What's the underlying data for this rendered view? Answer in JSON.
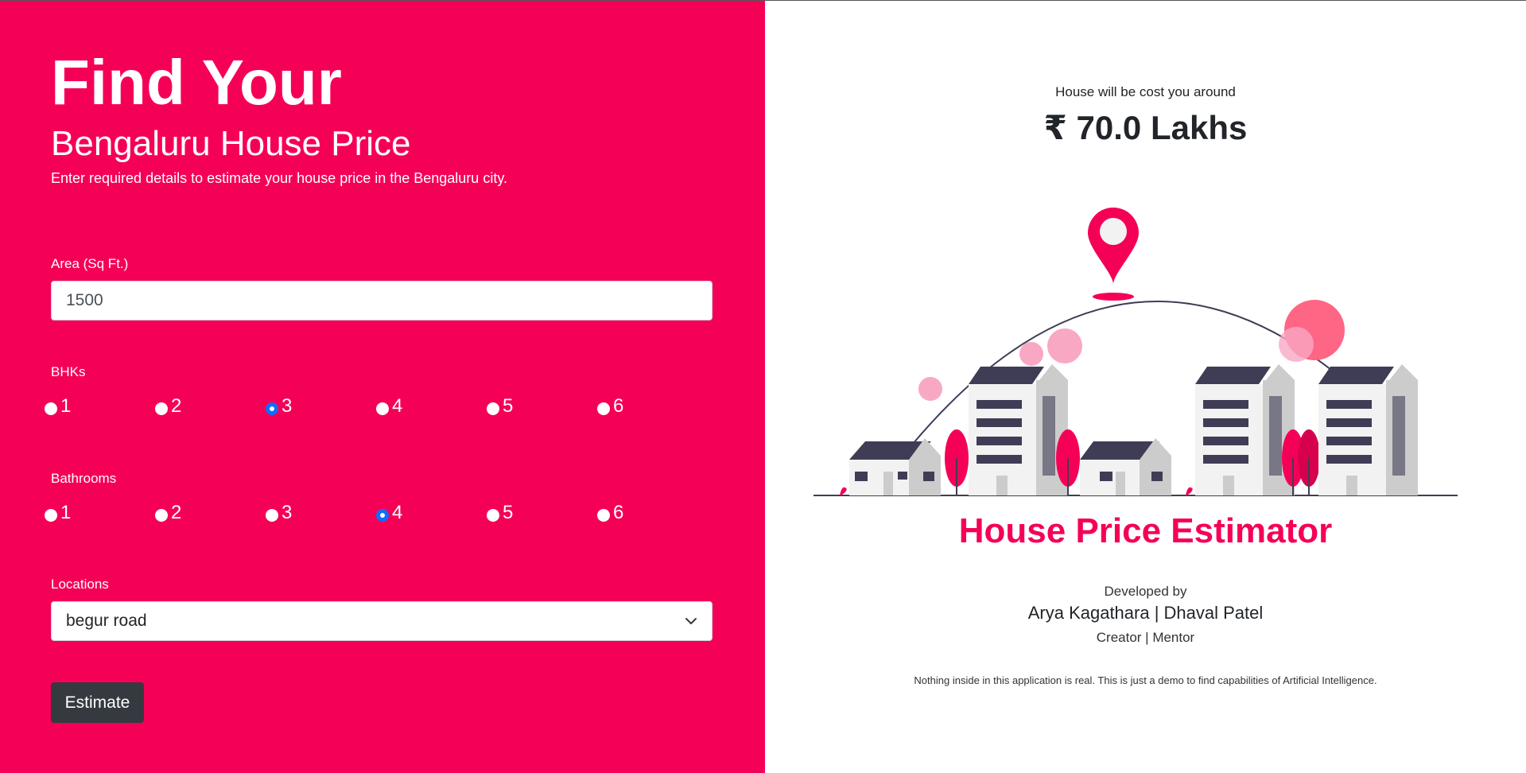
{
  "form": {
    "heading": "Find Your",
    "subheading": "Bengaluru House Price",
    "description": "Enter required details to estimate your house price in the Bengaluru city.",
    "area": {
      "label": "Area (Sq Ft.)",
      "value": "1500"
    },
    "bhk": {
      "label": "BHKs",
      "options": [
        "1",
        "2",
        "3",
        "4",
        "5",
        "6"
      ],
      "selected": "3"
    },
    "bathrooms": {
      "label": "Bathrooms",
      "options": [
        "1",
        "2",
        "3",
        "4",
        "5",
        "6"
      ],
      "selected": "4"
    },
    "location": {
      "label": "Locations",
      "selected": "begur road"
    },
    "estimate_label": "Estimate"
  },
  "result": {
    "caption": "House will be cost you around",
    "value": "₹ 70.0 Lakhs"
  },
  "brand": {
    "title": "House Price Estimator",
    "developed_by": "Developed by",
    "names": "Arya Kagathara | Dhaval Patel",
    "roles": "Creator | Mentor",
    "disclaimer": "Nothing inside in this application is real. This is just a demo to find capabilities of Artificial Intelligence."
  },
  "colors": {
    "accent": "#f50057",
    "button": "#343a40",
    "radio_checked": "#0d6efd",
    "building_roof": "#3f3d56",
    "building_wall": "#cccccc"
  },
  "icons": {
    "location_pin": "map-pin-icon",
    "dropdown": "chevron-down-icon"
  }
}
